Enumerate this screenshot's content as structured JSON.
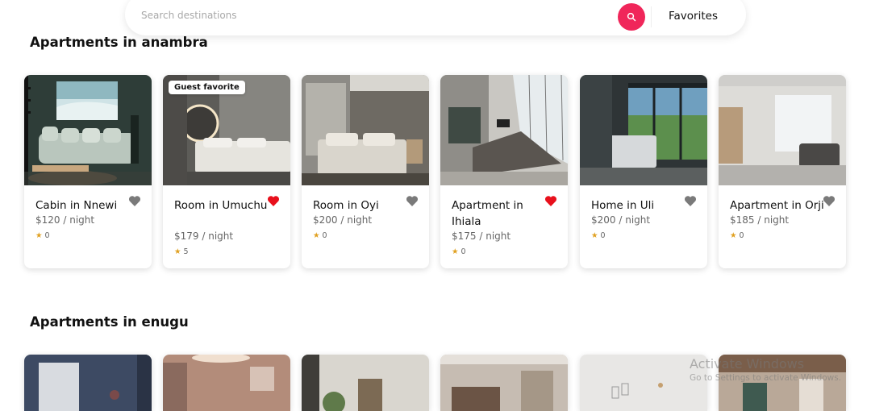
{
  "search": {
    "placeholder": "Search destinations",
    "value": "",
    "button_icon": "search-icon",
    "button_color": "#f0265a"
  },
  "nav": {
    "favorites_label": "Favorites"
  },
  "colors": {
    "accent": "#f0265a",
    "heart_active": "#e8101c",
    "heart_inactive": "#7a7a7a",
    "star": "#e0a020"
  },
  "sections": [
    {
      "title": "Apartments in anambra",
      "cards": [
        {
          "title": "Cabin in Nnewi",
          "price": "$120 / night",
          "rating": "0",
          "favorite": false,
          "badge": ""
        },
        {
          "title": "Room in Umuchu",
          "price": "$179 / night",
          "rating": "5",
          "favorite": true,
          "badge": "Guest favorite"
        },
        {
          "title": "Room in Oyi",
          "price": "$200 / night",
          "rating": "0",
          "favorite": false,
          "badge": ""
        },
        {
          "title": "Apartment in Ihiala",
          "price": "$175 / night",
          "rating": "0",
          "favorite": true,
          "badge": ""
        },
        {
          "title": "Home in Uli",
          "price": "$200 / night",
          "rating": "0",
          "favorite": false,
          "badge": ""
        },
        {
          "title": "Apartment in Orji",
          "price": "$185 / night",
          "rating": "0",
          "favorite": false,
          "badge": ""
        }
      ]
    },
    {
      "title": "Apartments in enugu",
      "cards": []
    }
  ],
  "watermark": {
    "line1": "Activate Windows",
    "line2": "Go to Settings to activate Windows."
  }
}
